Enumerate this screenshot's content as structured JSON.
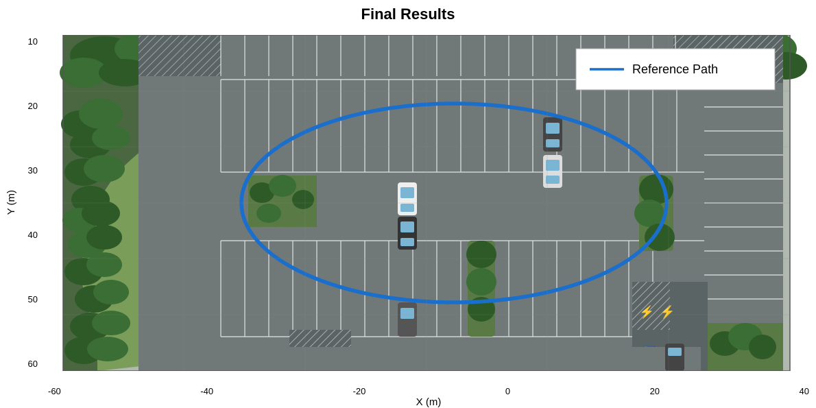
{
  "title": "Final Results",
  "yAxis": {
    "label": "Y (m)",
    "ticks": [
      "10",
      "20",
      "30",
      "40",
      "50",
      "60"
    ]
  },
  "xAxis": {
    "label": "X (m)",
    "ticks": [
      "-60",
      "-40",
      "-20",
      "0",
      "20",
      "40"
    ]
  },
  "legend": {
    "label": "Reference Path",
    "lineColor": "#1a6fcc"
  }
}
